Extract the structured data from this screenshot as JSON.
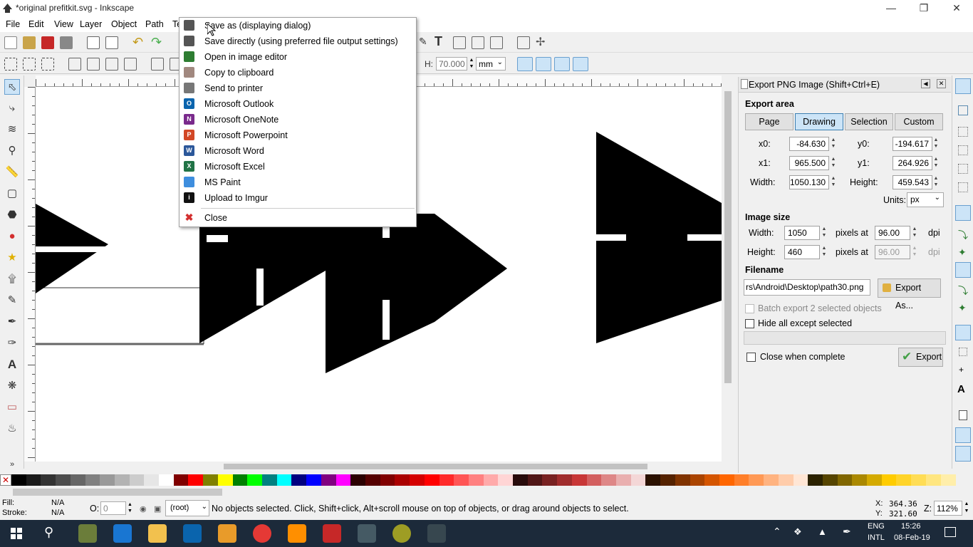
{
  "window": {
    "title": "*original prefitkit.svg - Inkscape"
  },
  "menubar": [
    "File",
    "Edit",
    "View",
    "Layer",
    "Object",
    "Path",
    "Te"
  ],
  "toolbar": {
    "h_label": "H:",
    "h_value": "70.000",
    "unit": "mm"
  },
  "popup": {
    "items": [
      {
        "label": "Save as (displaying dialog)",
        "icon": "save-icon",
        "color": "#555"
      },
      {
        "label": "Save directly (using preferred file output settings)",
        "icon": "save-icon",
        "color": "#555"
      },
      {
        "label": "Open in image editor",
        "icon": "image-editor-icon",
        "color": "#2e7d32"
      },
      {
        "label": "Copy to clipboard",
        "icon": "clipboard-icon",
        "color": "#a1887f"
      },
      {
        "label": "Send to printer",
        "icon": "printer-icon",
        "color": "#777"
      },
      {
        "label": "Microsoft Outlook",
        "icon": "outlook-icon",
        "color": "#0a64ad"
      },
      {
        "label": "Microsoft OneNote",
        "icon": "onenote-icon",
        "color": "#7a2a8c"
      },
      {
        "label": "Microsoft Powerpoint",
        "icon": "powerpoint-icon",
        "color": "#d24726"
      },
      {
        "label": "Microsoft Word",
        "icon": "word-icon",
        "color": "#2b579a"
      },
      {
        "label": "Microsoft Excel",
        "icon": "excel-icon",
        "color": "#217346"
      },
      {
        "label": "MS Paint",
        "icon": "paint-icon",
        "color": "#3e8ede"
      },
      {
        "label": "Upload to Imgur",
        "icon": "imgur-icon",
        "color": "#111"
      }
    ],
    "close_label": "Close"
  },
  "export": {
    "title": "Export PNG Image (Shift+Ctrl+E)",
    "area_label": "Export area",
    "tabs": [
      "Page",
      "Drawing",
      "Selection",
      "Custom"
    ],
    "active_tab": "Drawing",
    "x0_label": "x0:",
    "x0": "-84.630",
    "y0_label": "y0:",
    "y0": "-194.617",
    "x1_label": "x1:",
    "x1": "965.500",
    "y1_label": "y1:",
    "y1": "264.926",
    "width_label": "Width:",
    "width": "1050.130",
    "height_label": "Height:",
    "height": "459.543",
    "units_label": "Units:",
    "units": "px",
    "size_label": "Image size",
    "img_width_label": "Width:",
    "img_width": "1050",
    "img_height_label": "Height:",
    "img_height": "460",
    "pixels_at": "pixels at",
    "dpi_w": "96.00",
    "dpi_h": "96.00",
    "dpi": "dpi",
    "filename_label": "Filename",
    "filename": "rs\\Android\\Desktop\\path30.png",
    "export_as": "Export As...",
    "batch": "Batch export 2 selected objects",
    "hide_all": "Hide all except selected",
    "close_when": "Close when complete",
    "export_btn": "Export"
  },
  "status": {
    "fill_label": "Fill:",
    "fill": "N/A",
    "stroke_label": "Stroke:",
    "stroke": "N/A",
    "opacity_label": "O:",
    "opacity": "0",
    "layer": "(root)",
    "message": "No objects selected. Click, Shift+click, Alt+scroll mouse on top of objects, or drag around objects to select.",
    "x_label": "X:",
    "x": "364.36",
    "y_label": "Y:",
    "y": "321.60",
    "z_label": "Z:",
    "zoom": "112%"
  },
  "taskbar": {
    "lang": "ENG",
    "lang2": "INTL",
    "time": "15:26",
    "date": "08-Feb-19"
  }
}
